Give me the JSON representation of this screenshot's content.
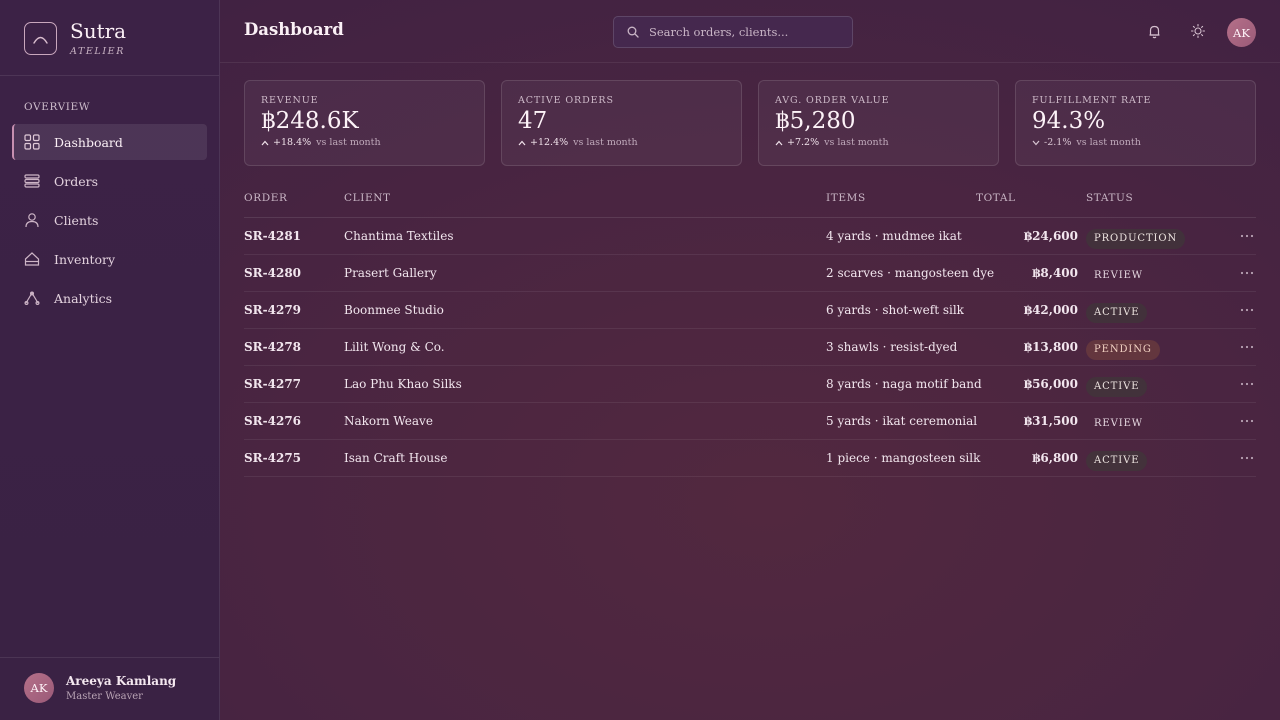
{
  "brand": {
    "name": "Sutra",
    "subtitle": "ATELIER"
  },
  "sidebar": {
    "section": "OVERVIEW",
    "items": [
      {
        "label": "Dashboard",
        "icon": "grid-icon",
        "active": true
      },
      {
        "label": "Orders",
        "icon": "stack-icon"
      },
      {
        "label": "Clients",
        "icon": "user-icon"
      },
      {
        "label": "Inventory",
        "icon": "box-icon"
      },
      {
        "label": "Analytics",
        "icon": "graph-icon"
      }
    ]
  },
  "user": {
    "initials": "AK",
    "name": "Areeya Kamlang",
    "role": "Master Weaver"
  },
  "header": {
    "title": "Dashboard",
    "search_placeholder": "Search orders, clients...",
    "avatar_initials": "AK"
  },
  "stats": [
    {
      "label": "REVENUE",
      "value": "฿248.6K",
      "delta": "+18.4%",
      "direction": "up",
      "note": "vs last month"
    },
    {
      "label": "ACTIVE ORDERS",
      "value": "47",
      "delta": "+12.4%",
      "direction": "up",
      "note": "vs last month"
    },
    {
      "label": "AVG. ORDER VALUE",
      "value": "฿5,280",
      "delta": "+7.2%",
      "direction": "up",
      "note": "vs last month"
    },
    {
      "label": "FULFILLMENT RATE",
      "value": "94.3%",
      "delta": "-2.1%",
      "direction": "down",
      "note": "vs last month"
    }
  ],
  "table": {
    "columns": {
      "order": "ORDER",
      "client": "CLIENT",
      "items": "ITEMS",
      "total": "TOTAL",
      "status": "STATUS"
    },
    "rows": [
      {
        "order": "SR-4281",
        "client": "Chantima Textiles",
        "items": "4 yards · mudmee ikat",
        "total": "฿24,600",
        "status": "PRODUCTION"
      },
      {
        "order": "SR-4280",
        "client": "Prasert Gallery",
        "items": "2 scarves · mangosteen dye",
        "total": "฿8,400",
        "status": "REVIEW"
      },
      {
        "order": "SR-4279",
        "client": "Boonmee Studio",
        "items": "6 yards · shot-weft silk",
        "total": "฿42,000",
        "status": "ACTIVE"
      },
      {
        "order": "SR-4278",
        "client": "Lilit Wong & Co.",
        "items": "3 shawls · resist-dyed",
        "total": "฿13,800",
        "status": "PENDING"
      },
      {
        "order": "SR-4277",
        "client": "Lao Phu Khao Silks",
        "items": "8 yards · naga motif band",
        "total": "฿56,000",
        "status": "ACTIVE"
      },
      {
        "order": "SR-4276",
        "client": "Nakorn Weave",
        "items": "5 yards · ikat ceremonial",
        "total": "฿31,500",
        "status": "REVIEW"
      },
      {
        "order": "SR-4275",
        "client": "Isan Craft House",
        "items": "1 piece · mangosteen silk",
        "total": "฿6,800",
        "status": "ACTIVE"
      }
    ]
  }
}
